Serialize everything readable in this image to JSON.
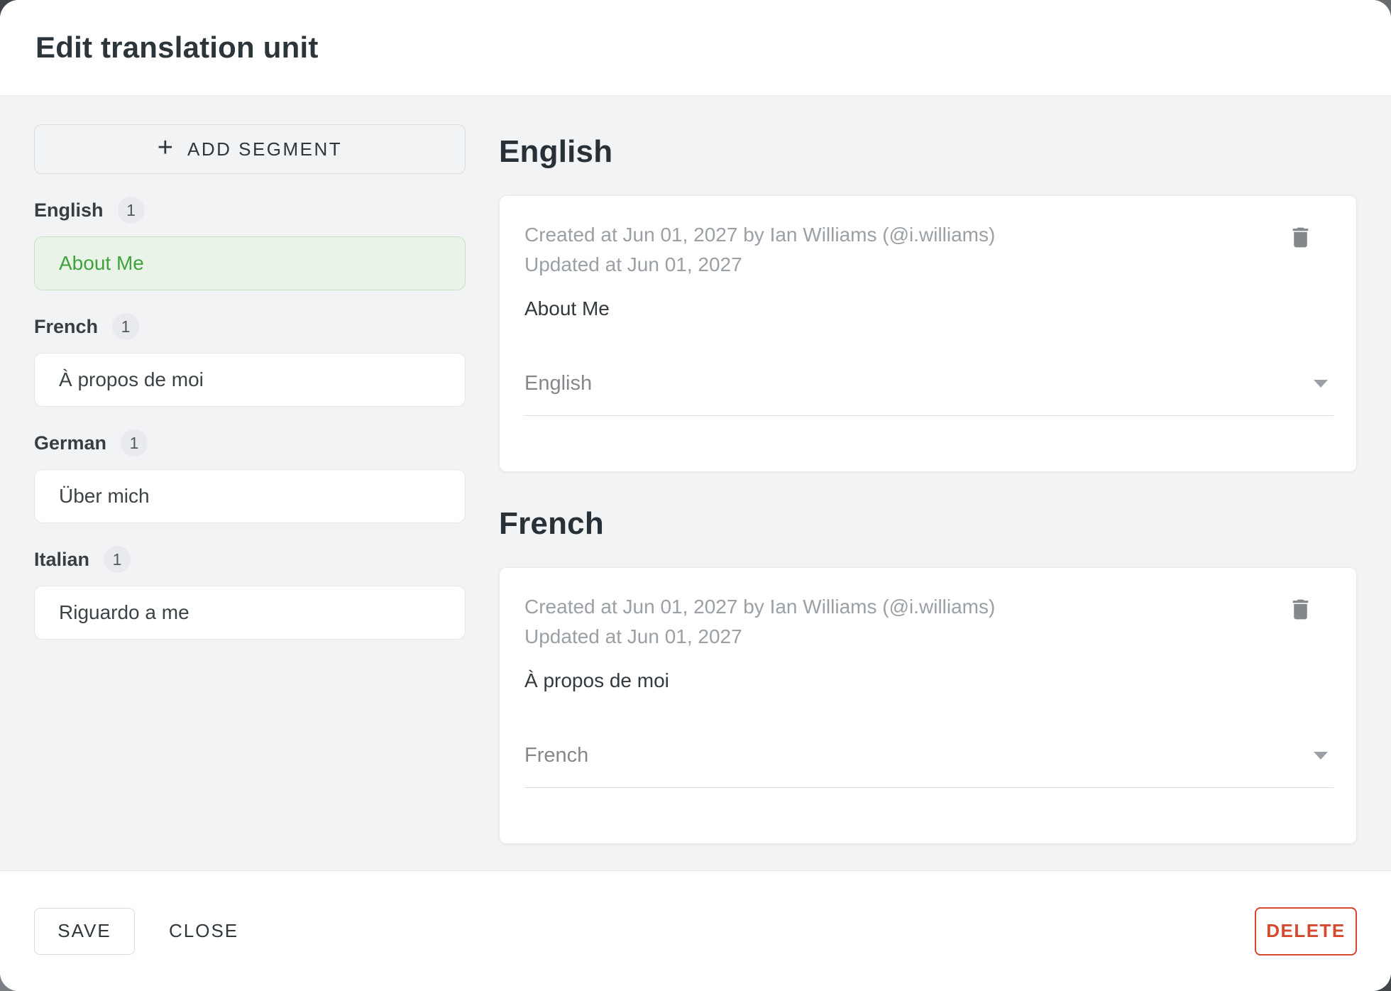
{
  "dialog": {
    "title": "Edit translation unit"
  },
  "sidebar": {
    "add_segment_label": "ADD SEGMENT",
    "plus_icon": "+",
    "groups": [
      {
        "language": "English",
        "count": "1",
        "segment": "About Me",
        "selected": true
      },
      {
        "language": "French",
        "count": "1",
        "segment": "À propos de moi",
        "selected": false
      },
      {
        "language": "German",
        "count": "1",
        "segment": "Über mich",
        "selected": false
      },
      {
        "language": "Italian",
        "count": "1",
        "segment": "Riguardo a me",
        "selected": false
      }
    ]
  },
  "main": {
    "sections": [
      {
        "heading": "English",
        "created_line": "Created at Jun 01, 2027 by Ian Williams (@i.williams)",
        "updated_line": "Updated at Jun 01, 2027",
        "text": "About Me",
        "language_select": "English"
      },
      {
        "heading": "French",
        "created_line": "Created at Jun 01, 2027 by Ian Williams (@i.williams)",
        "updated_line": "Updated at Jun 01, 2027",
        "text": "À propos de moi",
        "language_select": "French"
      }
    ]
  },
  "footer": {
    "save_label": "SAVE",
    "close_label": "CLOSE",
    "delete_label": "DELETE"
  },
  "colors": {
    "selected_green_text": "#3fa23c",
    "selected_green_bg": "#eaf3e8",
    "selected_green_border": "#c9e0c6",
    "delete_red": "#d5492e",
    "content_bg": "#f1f3f4",
    "meta_gray": "#9aa0a5"
  },
  "icons": {
    "trash": "trash-icon",
    "dropdown": "chevron-down-icon",
    "plus": "plus-icon"
  }
}
